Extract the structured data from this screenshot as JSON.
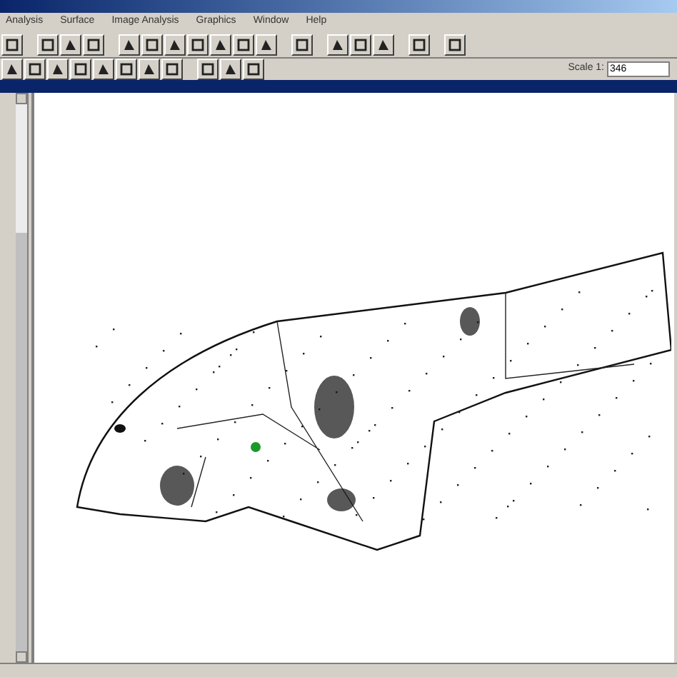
{
  "menu": [
    {
      "label": "Analysis"
    },
    {
      "label": "Surface"
    },
    {
      "label": "Image Analysis"
    },
    {
      "label": "Graphics"
    },
    {
      "label": "Window"
    },
    {
      "label": "Help"
    }
  ],
  "scale": {
    "label": "Scale 1:",
    "value": "346"
  }
}
